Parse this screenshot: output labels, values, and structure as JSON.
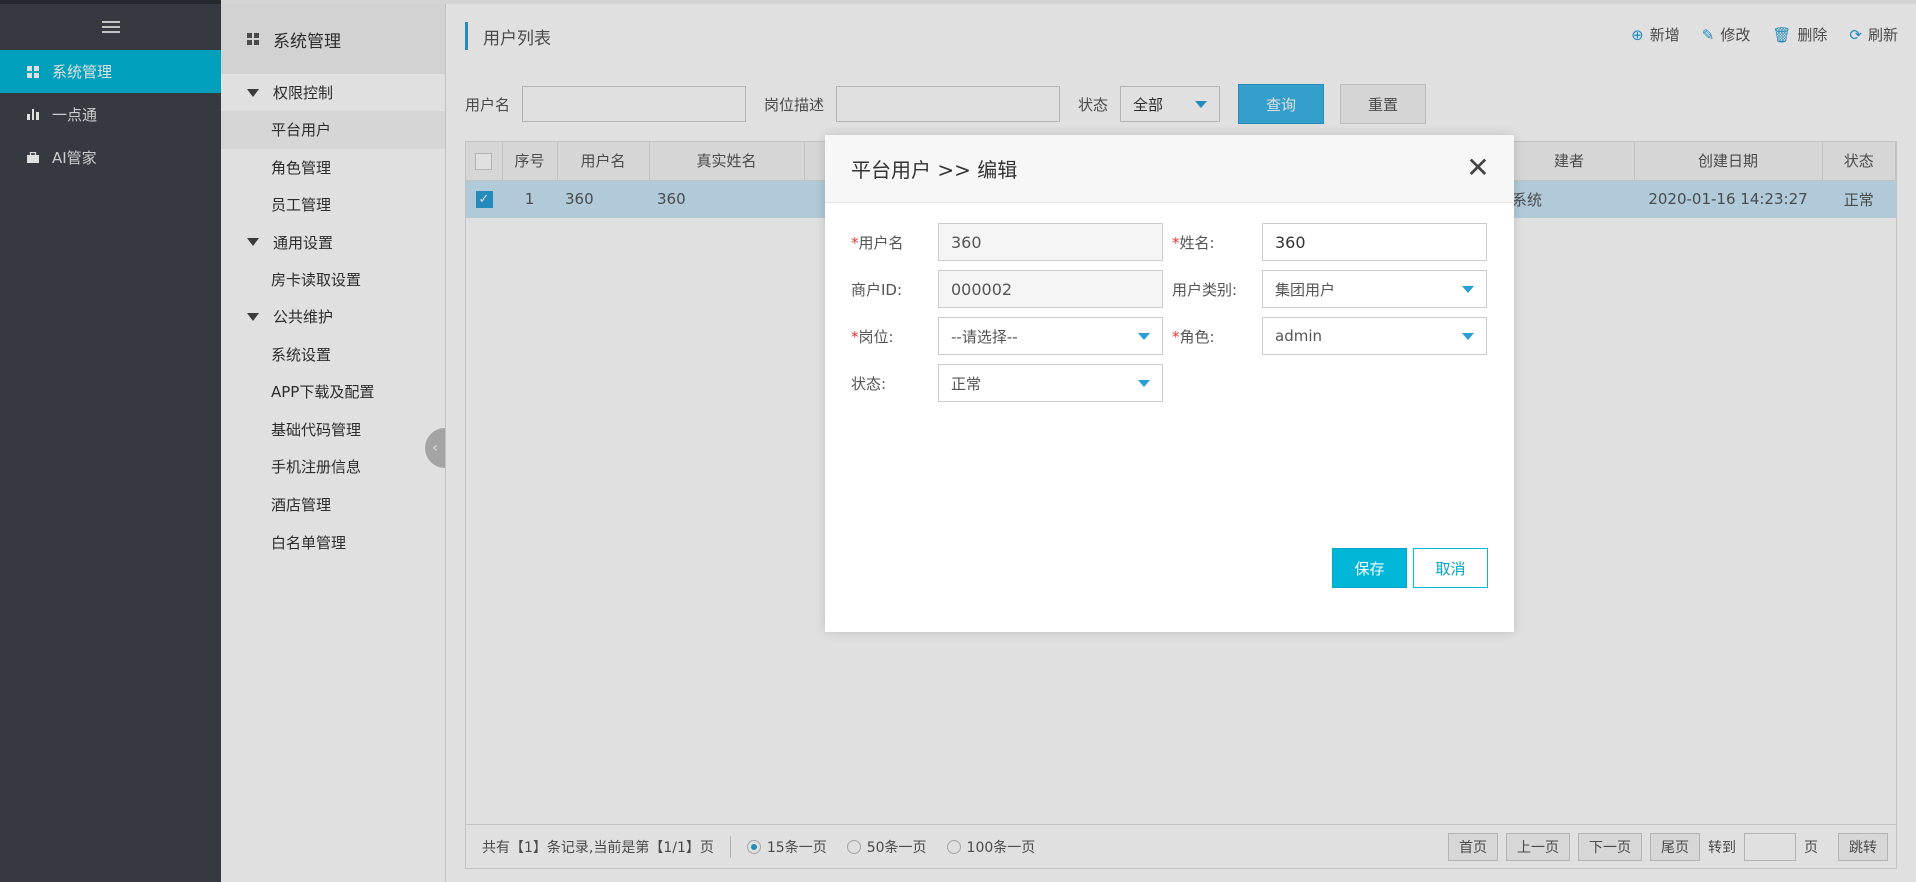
{
  "leftnav": {
    "items": [
      {
        "label": "系统管理",
        "icon": "grid-icon",
        "active": true
      },
      {
        "label": "一点通",
        "icon": "bar-chart-icon",
        "active": false
      },
      {
        "label": "AI管家",
        "icon": "briefcase-icon",
        "active": false
      }
    ]
  },
  "subnav": {
    "title": "系统管理",
    "groups": [
      {
        "label": "权限控制",
        "items": [
          "平台用户",
          "角色管理",
          "员工管理"
        ]
      },
      {
        "label": "通用设置",
        "items": [
          "房卡读取设置"
        ]
      },
      {
        "label": "公共维护",
        "items": [
          "系统设置",
          "APP下载及配置",
          "基础代码管理",
          "手机注册信息",
          "酒店管理",
          "白名单管理"
        ]
      }
    ],
    "active_item": "平台用户"
  },
  "main": {
    "title": "用户列表",
    "toolbar": {
      "add": "新增",
      "edit": "修改",
      "delete": "删除",
      "refresh": "刷新"
    },
    "filter": {
      "username_label": "用户名",
      "username_value": "",
      "post_label": "岗位描述",
      "post_value": "",
      "status_label": "状态",
      "status_value": "全部",
      "query_label": "查询",
      "reset_label": "重置"
    },
    "table": {
      "headers": [
        "序号",
        "用户名",
        "真实姓名",
        "建者",
        "创建日期",
        "状态"
      ],
      "rows": [
        {
          "index": "1",
          "username": "360",
          "realname": "360",
          "creator": "系统",
          "created": "2020-01-16 14:23:27",
          "status": "正常",
          "checked": true
        }
      ]
    },
    "pager": {
      "summary": "共有【1】条记录,当前是第【1/1】页",
      "size_options": [
        "15条一页",
        "50条一页",
        "100条一页"
      ],
      "selected_size": "15条一页",
      "first": "首页",
      "prev": "上一页",
      "next": "下一页",
      "last": "尾页",
      "goto_label": "转到",
      "page_unit": "页",
      "jump": "跳转"
    }
  },
  "modal": {
    "title": "平台用户 >> 编辑",
    "fields": {
      "username_label": "用户名",
      "username_value": "360",
      "name_label": "姓名:",
      "name_value": "360",
      "merchant_label": "商户ID:",
      "merchant_value": "000002",
      "usertype_label": "用户类别:",
      "usertype_value": "集团用户",
      "post_label": "岗位:",
      "post_value": "--请选择--",
      "role_label": "角色:",
      "role_value": "admin",
      "status_label": "状态:",
      "status_value": "正常"
    },
    "save_label": "保存",
    "cancel_label": "取消"
  },
  "colors": {
    "accent": "#00b7d8",
    "nav_bg": "#3e4249",
    "required": "#ee3333"
  }
}
